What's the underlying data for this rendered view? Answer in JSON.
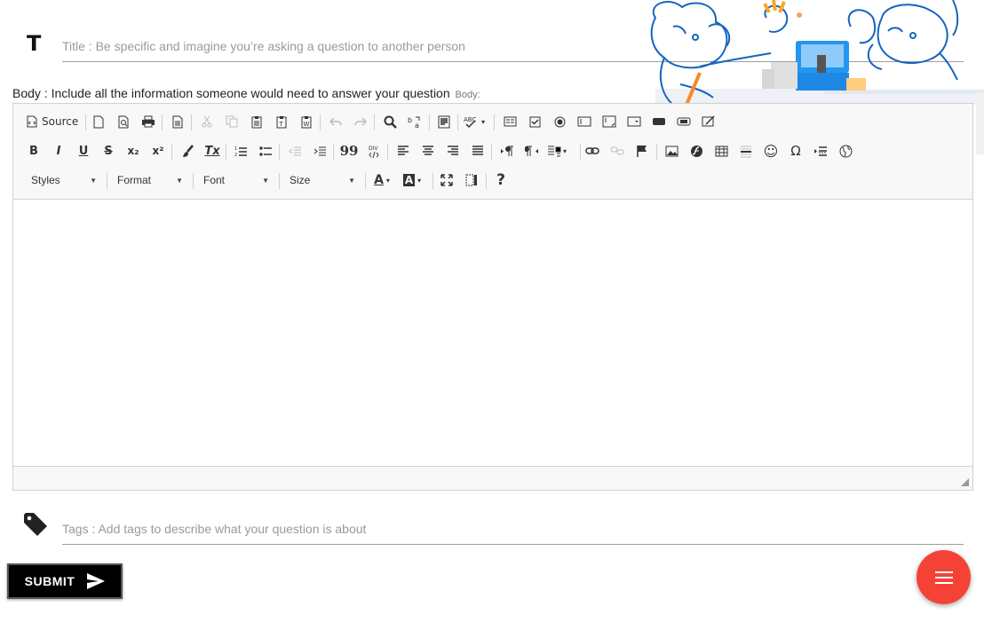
{
  "title": {
    "icon": "T",
    "placeholder": "Title : Be specific and imagine you’re asking a question to another person"
  },
  "body": {
    "label": "Body : Include all the information someone would need to answer your question",
    "small_label": "Body:"
  },
  "editor": {
    "source_label": "Source",
    "combos": {
      "styles": "Styles",
      "format": "Format",
      "font": "Font",
      "size": "Size"
    },
    "glyphs": {
      "bold": "B",
      "italic": "I",
      "underline": "U",
      "strike": "S",
      "subscript": "x₂",
      "superscript": "x²",
      "remove_format": "Tx",
      "blockquote": "99",
      "font_color": "A",
      "bg_color": "A",
      "about": "?",
      "omega": "Ω",
      "smiley": "☺",
      "abc": "ABC"
    }
  },
  "tags": {
    "placeholder": "Tags : Add tags to describe what your question is about"
  },
  "submit": {
    "label": "SUBMIT"
  },
  "colors": {
    "fab": "#f44336",
    "submit_bg": "#000000",
    "illustration_blue": "#1565c0",
    "illustration_accent": "#f9a825"
  }
}
